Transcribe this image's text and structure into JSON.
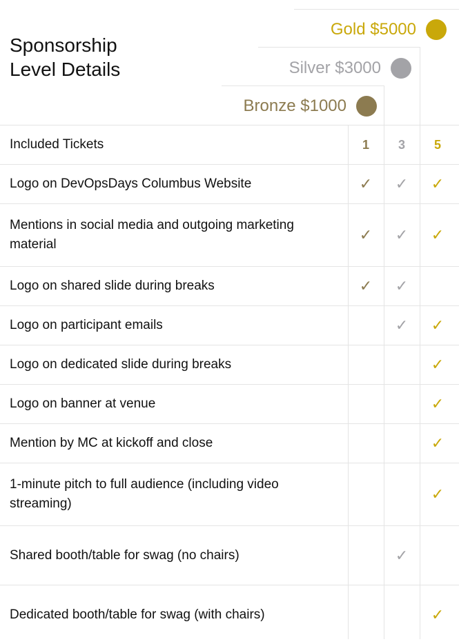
{
  "title": {
    "line1": "Sponsorship",
    "line2": "Level Details"
  },
  "colors": {
    "gold": "#c9a80a",
    "silver": "#a3a3a7",
    "bronze": "#8c7b50",
    "grid": "#e4e4e4"
  },
  "tiers": {
    "gold": {
      "label": "Gold $5000"
    },
    "silver": {
      "label": "Silver $3000"
    },
    "bronze": {
      "label": "Bronze $1000"
    }
  },
  "check_glyph": "✓",
  "rows": [
    {
      "label": "Included Tickets",
      "bronze": "1",
      "silver": "3",
      "gold": "5"
    },
    {
      "label": "Logo on DevOpsDays Columbus Website",
      "bronze": "✓",
      "silver": "✓",
      "gold": "✓"
    },
    {
      "label": "Mentions in social media and outgoing marketing material",
      "bronze": "✓",
      "silver": "✓",
      "gold": "✓"
    },
    {
      "label": "Logo on shared slide during breaks",
      "bronze": "✓",
      "silver": "✓",
      "gold": ""
    },
    {
      "label": "Logo on participant emails",
      "bronze": "",
      "silver": "✓",
      "gold": "✓"
    },
    {
      "label": "Logo on dedicated slide during breaks",
      "bronze": "",
      "silver": "",
      "gold": "✓"
    },
    {
      "label": "Logo on banner at venue",
      "bronze": "",
      "silver": "",
      "gold": "✓"
    },
    {
      "label": "Mention by MC at kickoff and close",
      "bronze": "",
      "silver": "",
      "gold": "✓"
    },
    {
      "label": "1-minute pitch to full audience (including video streaming)",
      "bronze": "",
      "silver": "",
      "gold": "✓"
    },
    {
      "label": "Shared booth/table for swag (no chairs)",
      "bronze": "",
      "silver": "✓",
      "gold": ""
    },
    {
      "label": "Dedicated booth/table for swag (with chairs)",
      "bronze": "",
      "silver": "",
      "gold": "✓"
    }
  ]
}
